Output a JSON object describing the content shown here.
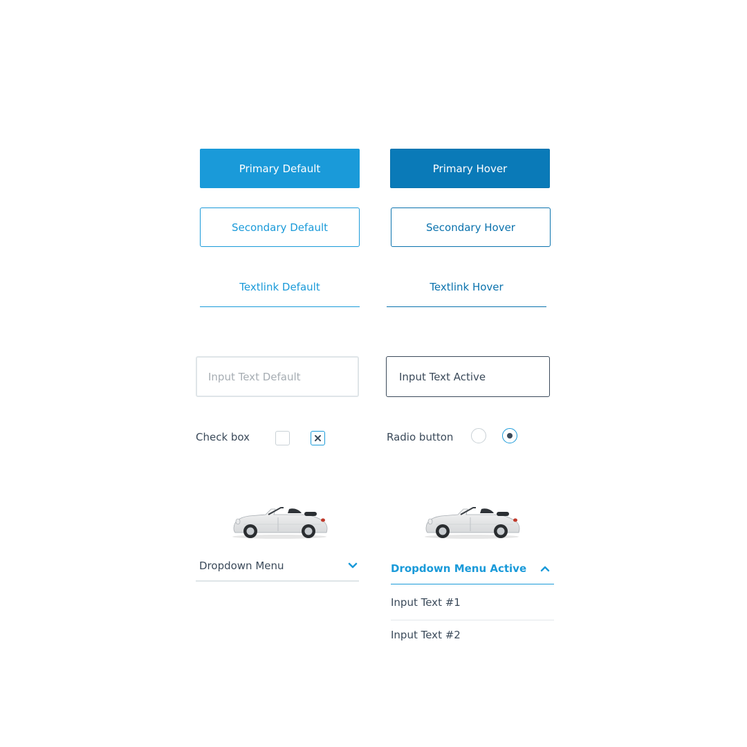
{
  "buttons": {
    "primary_default": "Primary Default",
    "primary_hover": "Primary Hover",
    "secondary_default": "Secondary Default",
    "secondary_hover": "Secondary Hover",
    "textlink_default": "Textlink Default",
    "textlink_hover": "Textlink Hover"
  },
  "inputs": {
    "default_placeholder": "Input Text Default",
    "active_value": "Input Text Active"
  },
  "checkbox": {
    "label": "Check box"
  },
  "radio": {
    "label": "Radio button"
  },
  "dropdown_default": {
    "label": "Dropdown Menu",
    "icon": "chevron-down-icon"
  },
  "dropdown_active": {
    "label": "Dropdown Menu Active",
    "icon": "chevron-up-icon",
    "options": [
      "Input Text #1",
      "Input Text #2"
    ]
  },
  "colors": {
    "primary": "#1a9ad9",
    "primary_hover": "#0a7ab8",
    "text": "#3b4a5a",
    "border_light": "#dfe5e8"
  }
}
